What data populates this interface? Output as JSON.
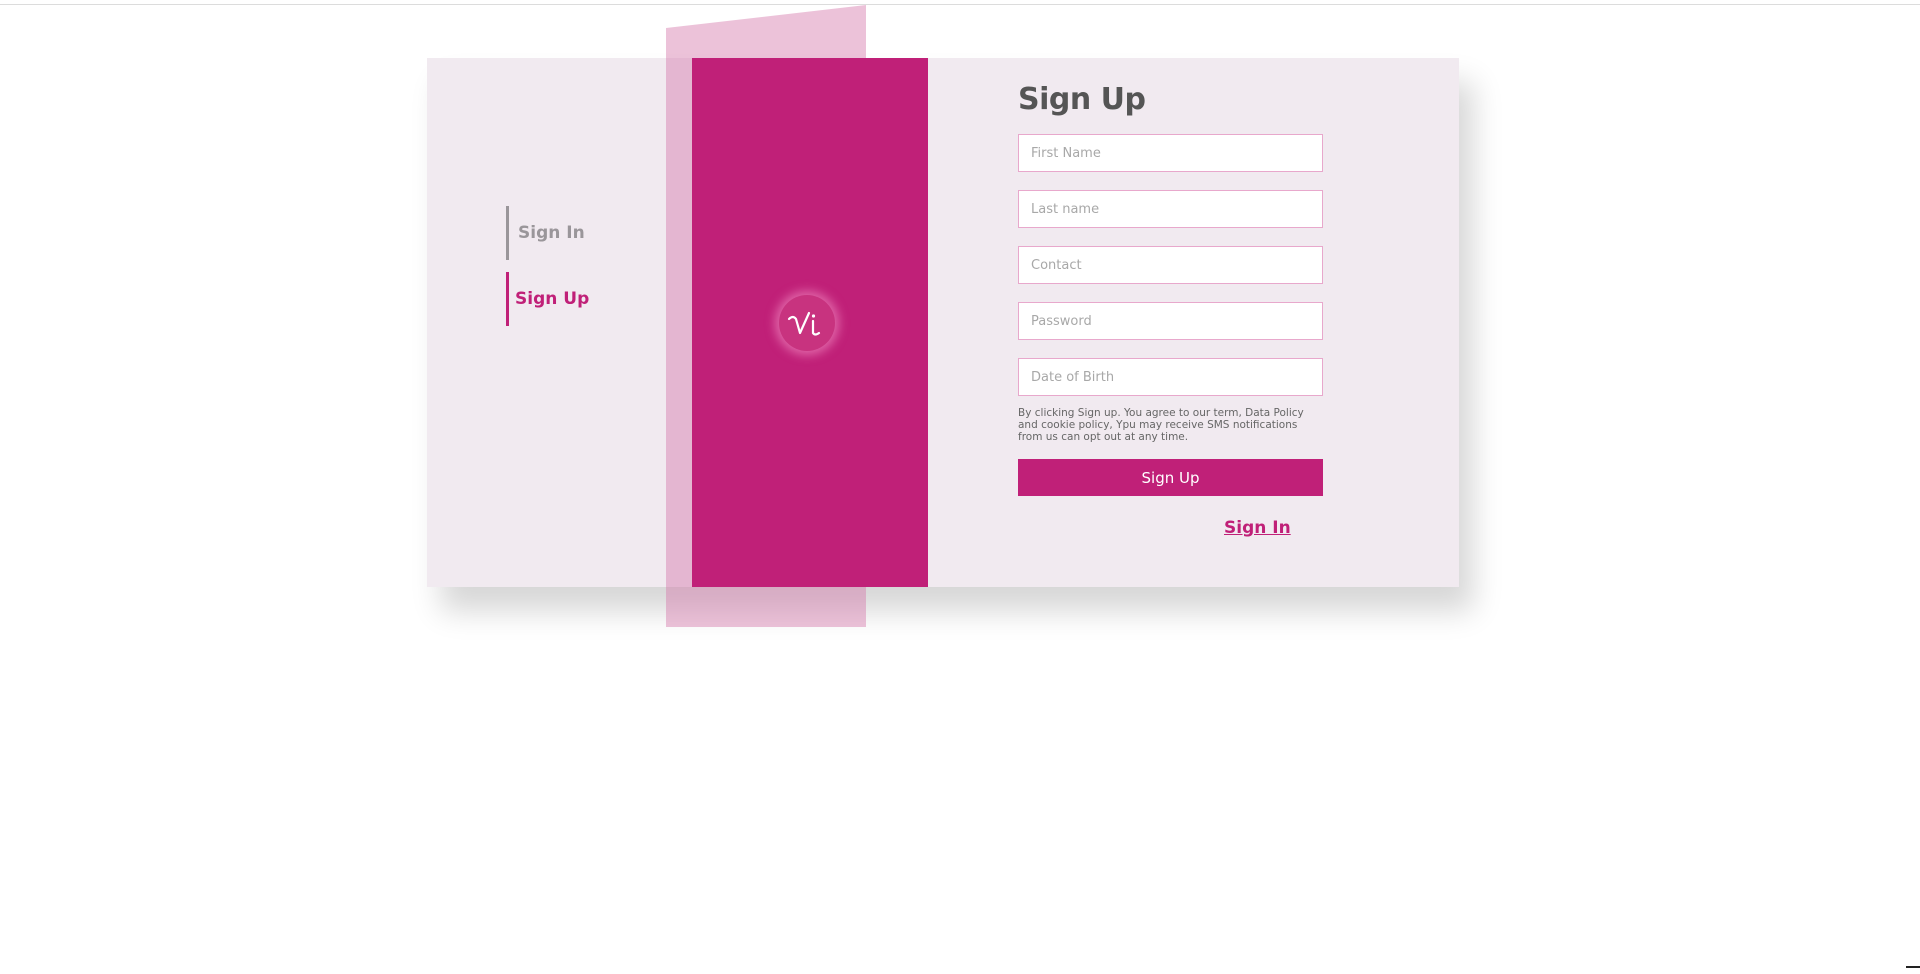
{
  "nav": {
    "signin_label": "Sign In",
    "signup_label": "Sign Up",
    "active": "Sign Up"
  },
  "brand": {
    "logo_icon": "vi-monogram-icon",
    "color": "#c02078"
  },
  "form": {
    "title": "Sign Up",
    "first_name_placeholder": "First Name",
    "last_name_placeholder": "Last name",
    "contact_placeholder": "Contact",
    "password_placeholder": "Password",
    "dob_placeholder": "Date of Birth",
    "terms_text": "By clicking Sign up. You agree to our term, Data Policy and cookie policy, Ypu may receive SMS notifications from us can opt out at any time.",
    "submit_label": "Sign Up",
    "alt_link_label": "Sign In"
  },
  "colors": {
    "accent": "#c02078",
    "card_bg": "#f1eaf0",
    "field_border": "#e8a8cc",
    "title_text": "#555555",
    "inactive_nav": "#9a969a"
  }
}
